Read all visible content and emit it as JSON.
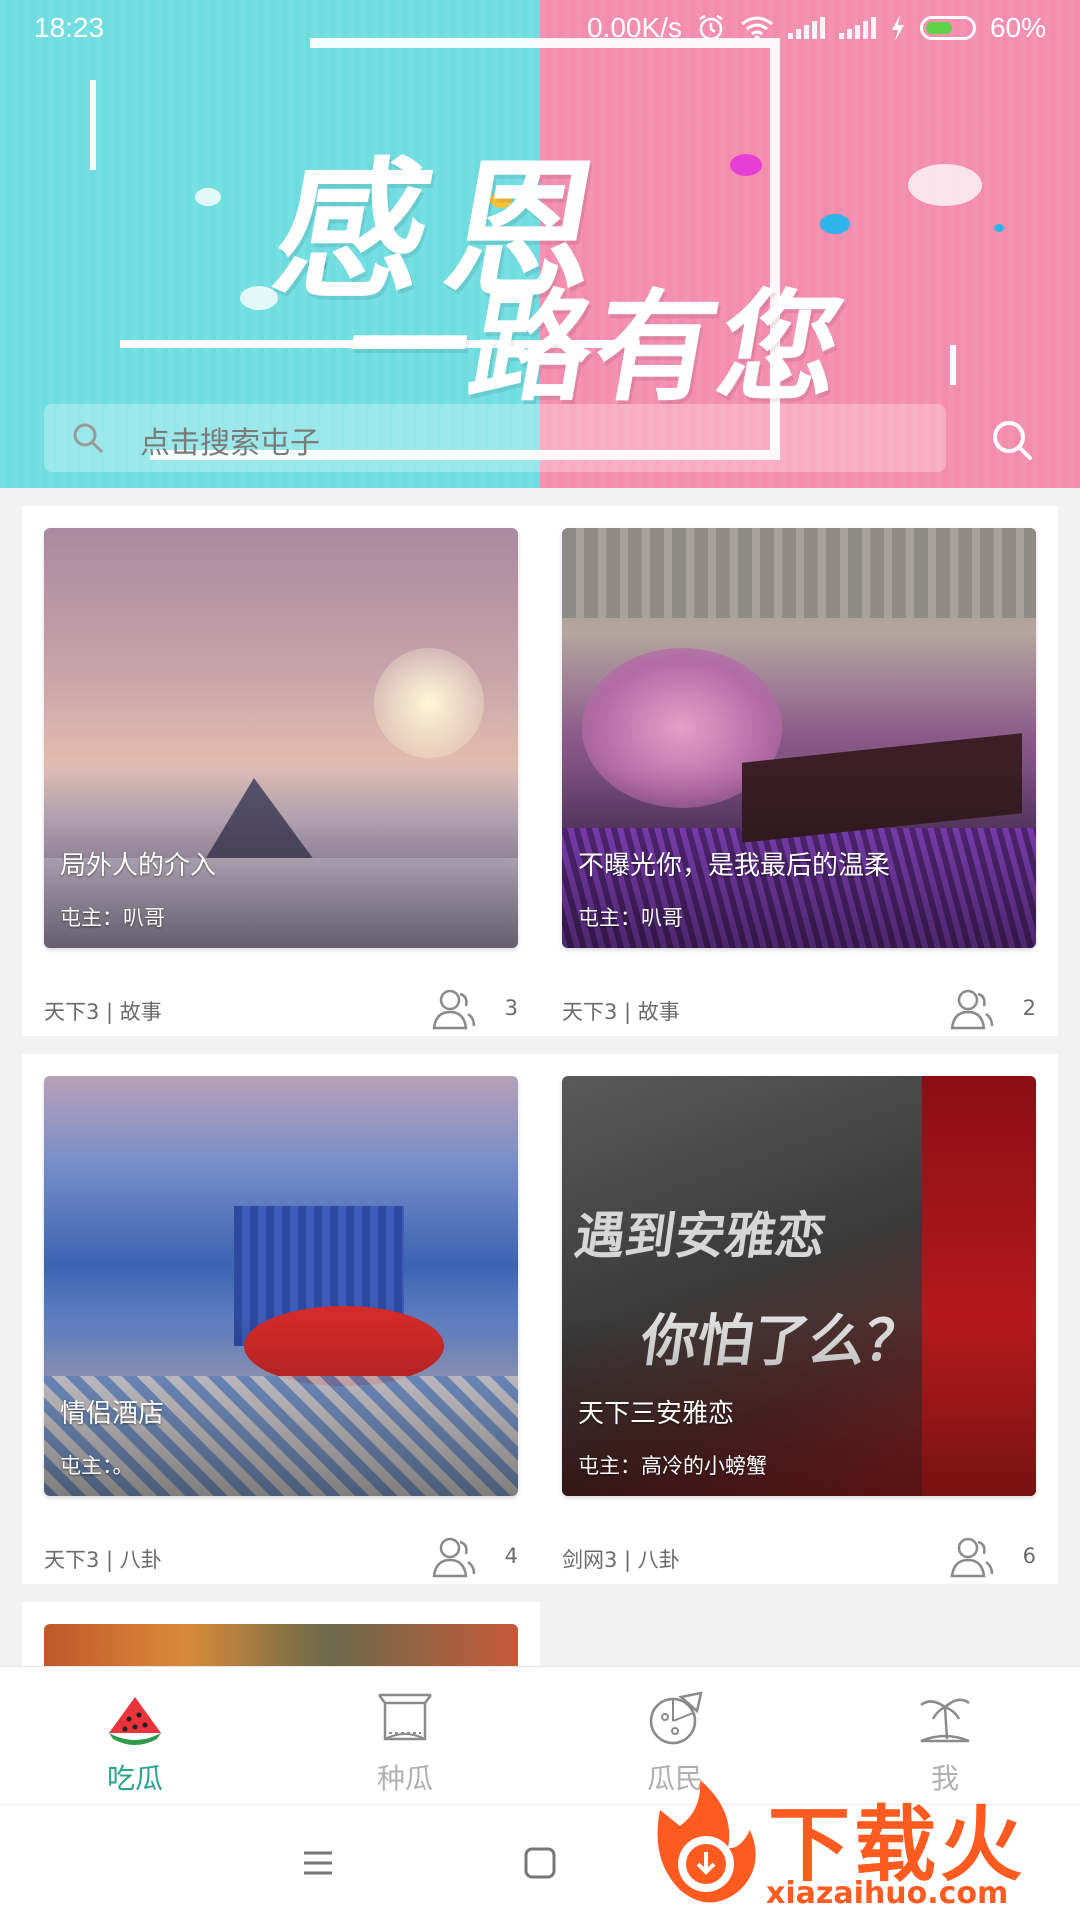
{
  "status_bar": {
    "time": "18:23",
    "net_speed": "0.00K/s",
    "battery": "60%",
    "battery_level": 0.6
  },
  "banner": {
    "slogan_line1": "感恩",
    "slogan_line2": "一路有您",
    "colors": {
      "left": "#6fdde0",
      "right": "#f48cae"
    }
  },
  "search": {
    "placeholder": "点击搜索屯子",
    "icon": "search-icon"
  },
  "cards": [
    {
      "title": "局外人的介入",
      "owner": "屯主：叭哥",
      "category": "天下3 | 故事",
      "members": "3"
    },
    {
      "title": "不曝光你，是我最后的温柔",
      "owner": "屯主：叭哥",
      "category": "天下3 | 故事",
      "members": "2"
    },
    {
      "title": "情侣酒店",
      "owner": "屯主：。",
      "category": "天下3 | 八卦",
      "members": "4"
    },
    {
      "title": "天下三安雅恋",
      "owner": "屯主：高冷的小螃蟹",
      "category": "剑网3 | 八卦",
      "members": "6"
    }
  ],
  "card_art_text": {
    "card4_line1": "遇到安雅恋",
    "card4_line2": "你怕了么？"
  },
  "tabbar": {
    "active_color": "#2aa48d",
    "items": [
      {
        "label": "吃瓜",
        "icon": "watermelon-icon",
        "active": true
      },
      {
        "label": "种瓜",
        "icon": "box-icon",
        "active": false
      },
      {
        "label": "瓜民",
        "icon": "pizza-icon",
        "active": false
      },
      {
        "label": "我",
        "icon": "island-icon",
        "active": false
      }
    ]
  },
  "system_nav": {
    "icons": [
      "menu-icon",
      "home-square-icon"
    ]
  },
  "watermark": {
    "text": "下载火",
    "url": "xiazaihuo.com"
  }
}
